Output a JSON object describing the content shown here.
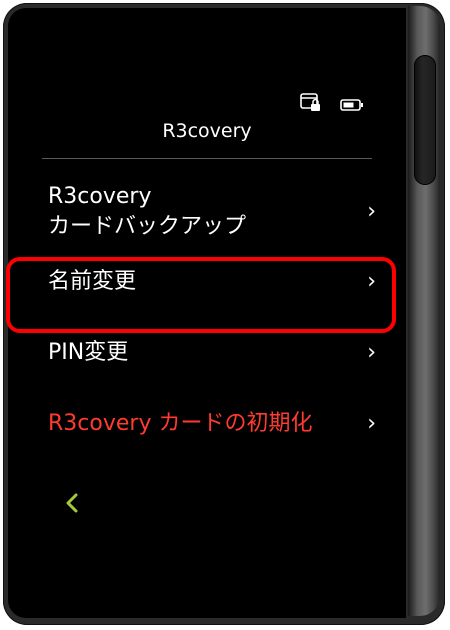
{
  "header": {
    "title": "R3covery",
    "icons": [
      "card-lock-icon",
      "battery-icon"
    ]
  },
  "menu": {
    "items": [
      {
        "line1": "R3covery",
        "line2": "カードバックアップ",
        "chevron": "›"
      },
      {
        "label": "名前変更",
        "chevron": "›"
      },
      {
        "label": "PIN変更",
        "chevron": "›"
      },
      {
        "label": "R3covery カードの初期化",
        "chevron": "›",
        "color": "#ff3b30"
      }
    ]
  },
  "highlight": {
    "color": "#ff0000",
    "target": "名前変更"
  },
  "back": {
    "icon": "chevron-left-icon",
    "color": "#a6c93a"
  }
}
